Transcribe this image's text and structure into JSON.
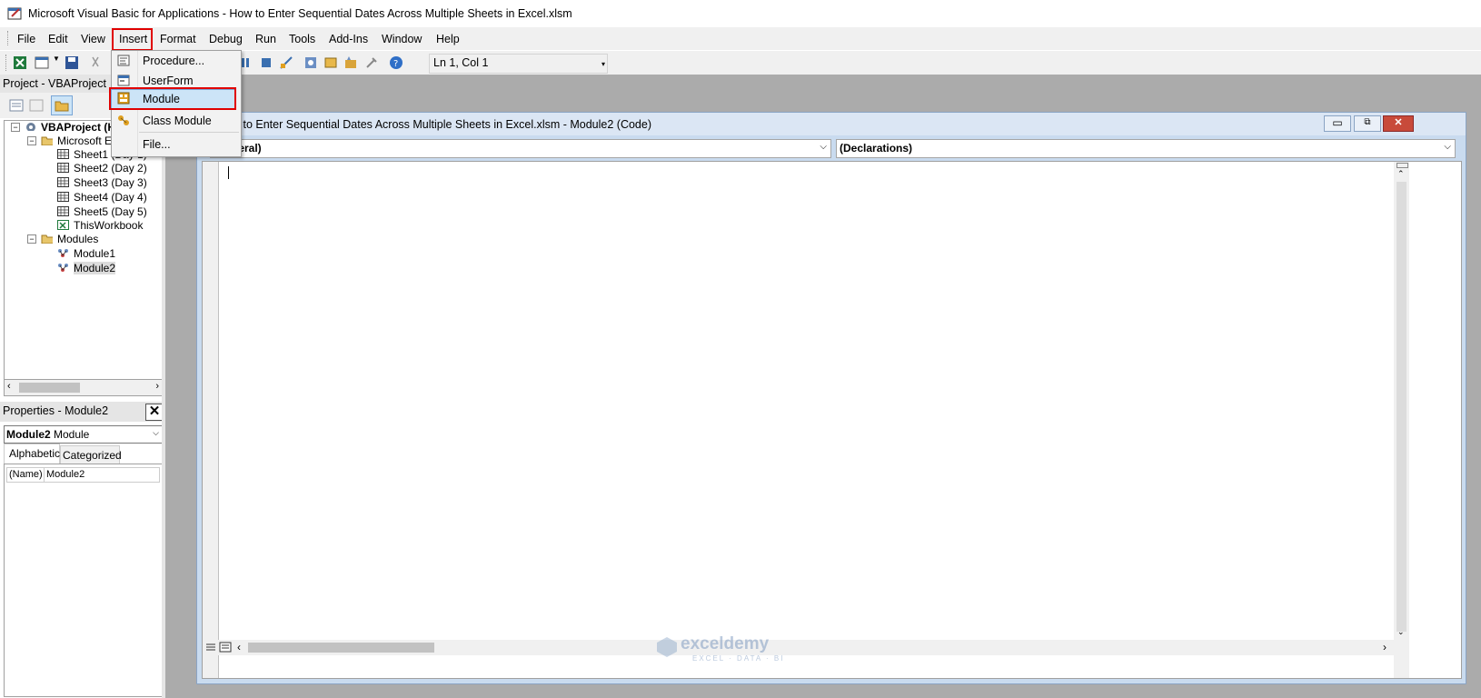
{
  "window": {
    "title": "Microsoft Visual Basic for Applications - How to Enter Sequential Dates Across Multiple Sheets in Excel.xlsm"
  },
  "menubar": {
    "items": [
      "File",
      "Edit",
      "View",
      "Insert",
      "Format",
      "Debug",
      "Run",
      "Tools",
      "Add-Ins",
      "Window",
      "Help"
    ]
  },
  "toolbar": {
    "position": "Ln 1, Col 1"
  },
  "insert_menu": {
    "items": [
      "Procedure...",
      "UserForm",
      "Module",
      "Class Module",
      "File..."
    ],
    "selected": "Module"
  },
  "project": {
    "header": "Project - VBAProject",
    "root": "VBAProject (H",
    "folder_objects": "Microsoft Ex",
    "sheets": [
      "Sheet1 (Day 1)",
      "Sheet2 (Day 2)",
      "Sheet3 (Day 3)",
      "Sheet4 (Day 4)",
      "Sheet5 (Day 5)",
      "ThisWorkbook"
    ],
    "folder_modules": "Modules",
    "modules": [
      "Module1",
      "Module2"
    ]
  },
  "properties": {
    "header": "Properties - Module2",
    "object_name": "Module2",
    "object_type": "Module",
    "tabs": [
      "Alphabetic",
      "Categorized"
    ],
    "rows": [
      {
        "name": "(Name)",
        "value": "Module2"
      }
    ]
  },
  "code_window": {
    "title": "How to Enter Sequential Dates Across Multiple Sheets in Excel.xlsm - Module2 (Code)",
    "object_combo": "(General)",
    "proc_combo": "(Declarations)"
  },
  "watermark": {
    "brand": "exceldemy",
    "tagline": "EXCEL · DATA · BI"
  },
  "colors": {
    "highlight_red": "#e00000",
    "selection_blue": "#cce4f7",
    "mdi_bg": "#ababab"
  }
}
